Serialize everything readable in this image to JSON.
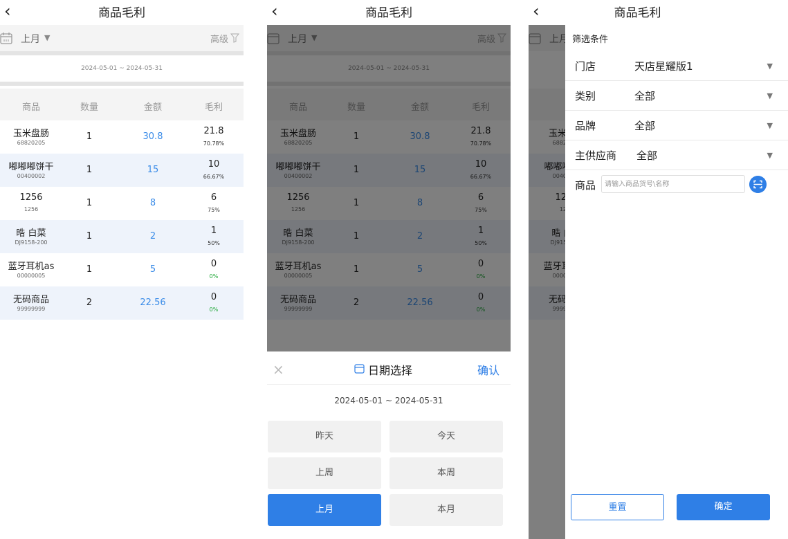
{
  "nav": {
    "title": "商品毛利",
    "back_icon": "‹"
  },
  "toolbar": {
    "period": "上月",
    "advanced": "高级"
  },
  "date_range": "2024-05-01 ~ 2024-05-31",
  "table": {
    "columns": [
      "商品",
      "数量",
      "金额",
      "毛利"
    ],
    "rows": [
      {
        "name": "玉米盘肠",
        "code": "68820205",
        "qty": "1",
        "amount": "30.8",
        "profit": "21.8",
        "pct": "70.78%"
      },
      {
        "name": "嘟嘟嘟饼干",
        "code": "00400002",
        "qty": "1",
        "amount": "15",
        "profit": "10",
        "pct": "66.67%"
      },
      {
        "name": "1256",
        "code": "1256",
        "qty": "1",
        "amount": "8",
        "profit": "6",
        "pct": "75%"
      },
      {
        "name": "晧 白菜",
        "code": "DJ9158-200",
        "qty": "1",
        "amount": "2",
        "profit": "1",
        "pct": "50%"
      },
      {
        "name": "蓝牙耳机as",
        "code": "00000005",
        "qty": "1",
        "amount": "5",
        "profit": "0",
        "pct": "0%"
      },
      {
        "name": "无码商品",
        "code": "99999999",
        "qty": "2",
        "amount": "22.56",
        "profit": "0",
        "pct": "0%"
      }
    ]
  },
  "date_sheet": {
    "title": "日期选择",
    "confirm": "确认",
    "close_icon": "×",
    "range": "2024-05-01 ~ 2024-05-31",
    "options": [
      "昨天",
      "今天",
      "上周",
      "本周",
      "上月",
      "本月"
    ],
    "selected": "上月"
  },
  "filter_drawer": {
    "header": "筛选条件",
    "fields": [
      {
        "label": "门店",
        "value": "天店星耀版1"
      },
      {
        "label": "类别",
        "value": "全部"
      },
      {
        "label": "品牌",
        "value": "全部"
      },
      {
        "label": "主供应商",
        "value": "全部"
      }
    ],
    "product_label": "商品",
    "product_placeholder": "请输入商品货号\\名称",
    "reset": "重置",
    "ok": "确定"
  },
  "colors": {
    "accent": "#2f7fe6",
    "amount": "#3b8ce8",
    "zero_pct": "#1aa632",
    "row_alt": "#eef3fb"
  }
}
